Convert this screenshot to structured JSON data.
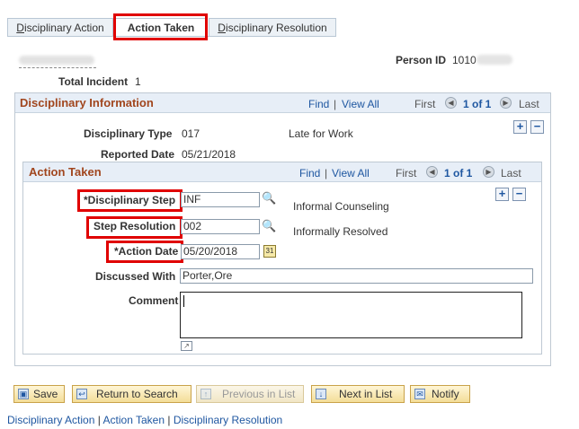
{
  "tabs": [
    {
      "label": "Disciplinary Action",
      "mnemonic": "D",
      "rest": "isciplinary Action"
    },
    {
      "label": "Action Taken"
    },
    {
      "label": "Disciplinary Resolution",
      "mnemonic": "D",
      "rest": "isciplinary Resolution"
    }
  ],
  "header": {
    "person_id_label": "Person ID",
    "person_id_value": "1010",
    "total_incident_label": "Total Incident",
    "total_incident_value": "1"
  },
  "disciplinary_information": {
    "title": "Disciplinary Information",
    "find": "Find",
    "sep": "|",
    "view_all": "View All",
    "first": "First",
    "count": "1 of 1",
    "last": "Last",
    "type_label": "Disciplinary Type",
    "type_code": "017",
    "type_desc": "Late for Work",
    "reported_label": "Reported Date",
    "reported_value": "05/21/2018"
  },
  "action_taken": {
    "title": "Action Taken",
    "find": "Find",
    "sep": "|",
    "view_all": "View All",
    "first": "First",
    "count": "1 of 1",
    "last": "Last",
    "step_label": "*Disciplinary Step",
    "step_value": "INF",
    "step_desc": "Informal Counseling",
    "resolution_label": "Step Resolution",
    "resolution_value": "002",
    "resolution_desc": "Informally Resolved",
    "action_date_label": "*Action Date",
    "action_date_value": "05/20/2018",
    "discussed_label": "Discussed With",
    "discussed_value": "Porter,Ore",
    "comment_label": "Comment",
    "comment_value": ""
  },
  "toolbar": {
    "save": "Save",
    "return": "Return to Search",
    "previous": "Previous in List",
    "next": "Next in List",
    "notify": "Notify"
  },
  "footer": {
    "link1": "Disciplinary Action",
    "sep": "|",
    "link2": "Action Taken",
    "link3": "Disciplinary Resolution"
  },
  "colors": {
    "highlight_box": "#e00000",
    "section_title": "#a1461e",
    "link": "#1f57a1"
  },
  "icons": {
    "lookup": "magnifier-icon",
    "calendar": "calendar-icon",
    "add": "plus-icon",
    "delete": "minus-icon",
    "prev": "left-arrow-icon",
    "next": "right-arrow-icon",
    "expand": "expand-icon"
  }
}
